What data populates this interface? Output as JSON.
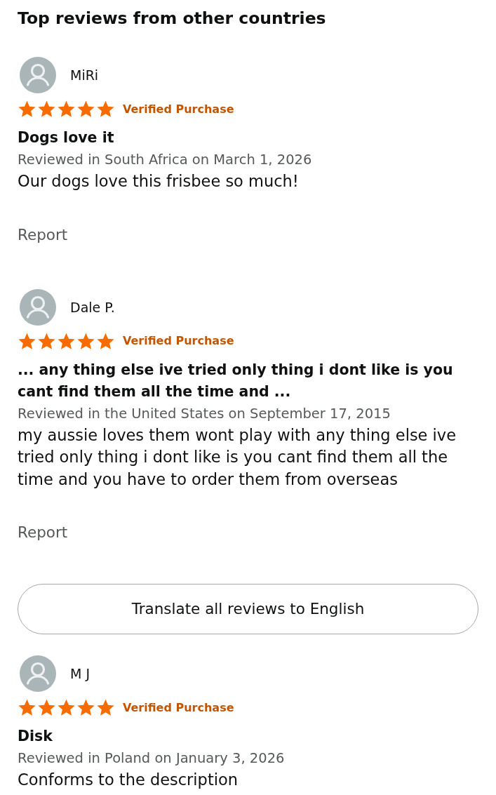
{
  "heading": "Top reviews from other countries",
  "items": [
    {
      "kind": "review",
      "reviewer": "MiRi",
      "stars": 5,
      "badge": "Verified Purchase",
      "title": "Dogs love it",
      "meta": "Reviewed in South Africa on March 1, 2026",
      "body": "Our dogs love this frisbee so much!",
      "report": "Report"
    },
    {
      "kind": "review",
      "reviewer": "Dale P.",
      "stars": 5,
      "badge": "Verified Purchase",
      "title": "... any thing else ive tried only thing i dont like is you cant find them all the time and ...",
      "meta": "Reviewed in the United States on September 17, 2015",
      "body": "my aussie loves them wont play with any thing else ive tried only thing i dont like is you cant find them all the time and you have to order them from overseas",
      "report": "Report"
    },
    {
      "kind": "button",
      "label": "Translate all reviews to English"
    },
    {
      "kind": "review",
      "reviewer": "M J",
      "stars": 5,
      "badge": "Verified Purchase",
      "title": "Disk",
      "meta": "Reviewed in Poland on January 3, 2026",
      "body": "Conforms to the description"
    }
  ]
}
